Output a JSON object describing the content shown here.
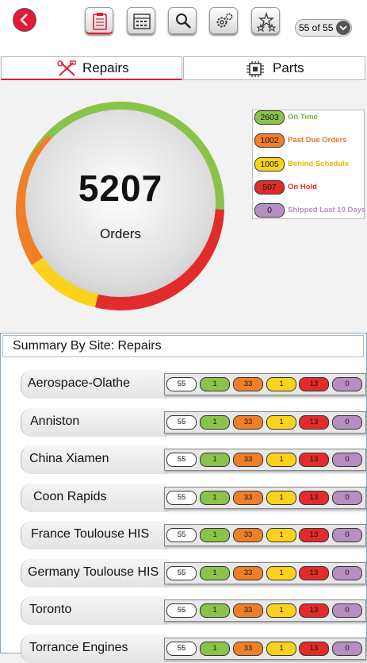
{
  "colors": {
    "accent": "#e31937",
    "green": "#8bc34a",
    "orange": "#f07f2a",
    "yellow": "#fcd21c",
    "red": "#e22b2b",
    "purple": "#b58fc0",
    "white": "#ffffff"
  },
  "toolbar": {
    "back_icon": "chevron-left-icon",
    "buttons": [
      {
        "icon": "clipboard-icon",
        "active": true
      },
      {
        "icon": "calendar-icon",
        "active": false
      },
      {
        "icon": "search-icon",
        "active": false
      },
      {
        "icon": "gears-icon",
        "active": false
      },
      {
        "icon": "stars-icon",
        "active": false
      }
    ],
    "pager": "55 of 55"
  },
  "tabs": {
    "repairs": "Repairs",
    "parts": "Parts"
  },
  "summary": {
    "total": "5207",
    "label": "Orders"
  },
  "legend": [
    {
      "value": "2603",
      "label": "On Time",
      "color": "#8bc34a",
      "text_color": "#7cb342"
    },
    {
      "value": "1002",
      "label": "Past Due Orders",
      "color": "#f07f2a",
      "text_color": "#e8732a"
    },
    {
      "value": "1005",
      "label": "Behind Schedule",
      "color": "#fcd21c",
      "text_color": "#e8b800"
    },
    {
      "value": "507",
      "label": "On Hold",
      "color": "#e22b2b",
      "text_color": "#e22b2b"
    },
    {
      "value": "0",
      "label": "Shipped Last 10 Days",
      "color": "#b58fc0",
      "text_color": "#b58fc0"
    }
  ],
  "section_title": "Summary By Site: Repairs",
  "sites": [
    {
      "name": "Aerospace-Olathe",
      "values": [
        "55",
        "1",
        "33",
        "1",
        "13",
        "0"
      ]
    },
    {
      "name": "Anniston",
      "values": [
        "55",
        "1",
        "33",
        "1",
        "13",
        "0"
      ]
    },
    {
      "name": "China Xiamen",
      "values": [
        "55",
        "1",
        "33",
        "1",
        "13",
        "0"
      ]
    },
    {
      "name": "Coon Rapids",
      "values": [
        "55",
        "1",
        "33",
        "1",
        "13",
        "0"
      ]
    },
    {
      "name": "France Toulouse HIS",
      "values": [
        "55",
        "1",
        "33",
        "1",
        "13",
        "0"
      ]
    },
    {
      "name": "Germany Toulouse HIS",
      "values": [
        "55",
        "1",
        "33",
        "1",
        "13",
        "0"
      ]
    },
    {
      "name": "Toronto",
      "values": [
        "55",
        "1",
        "33",
        "1",
        "13",
        "0"
      ]
    },
    {
      "name": "Torrance Engines",
      "values": [
        "55",
        "1",
        "33",
        "1",
        "13",
        "0"
      ]
    }
  ]
}
